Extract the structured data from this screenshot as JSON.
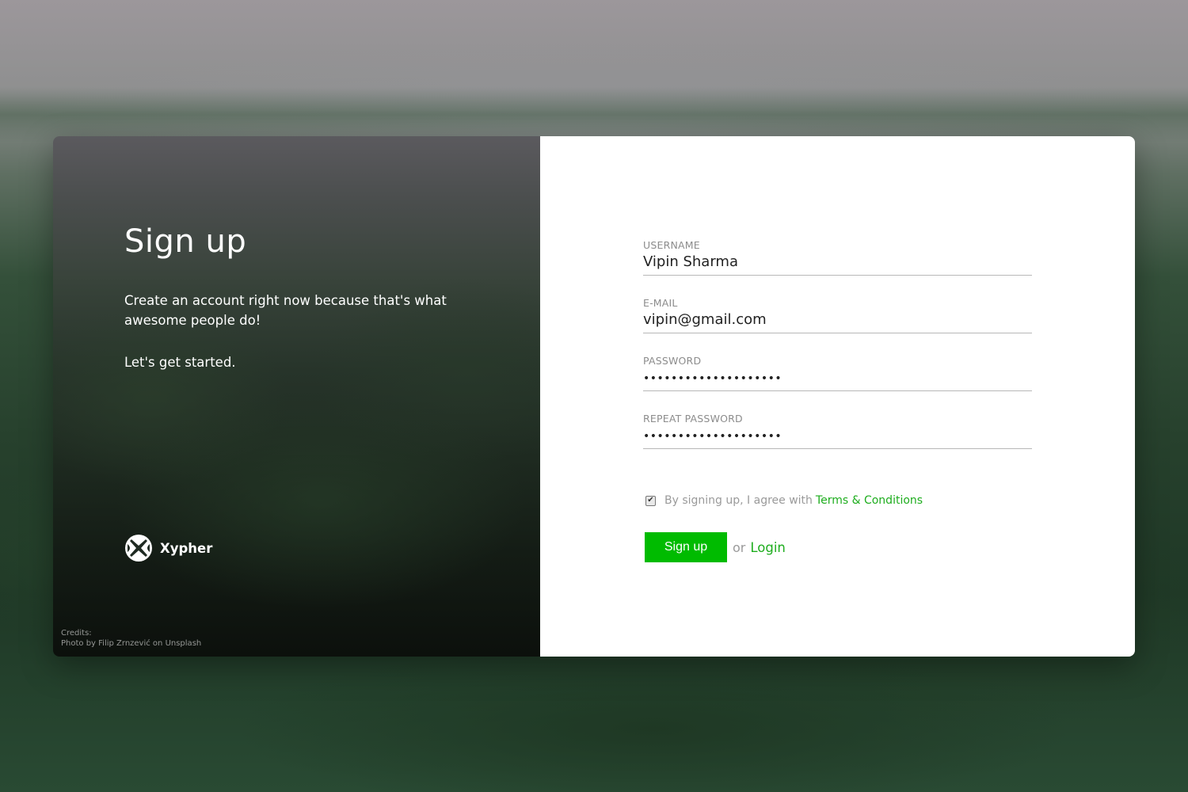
{
  "colors": {
    "accent": "#00bb00",
    "link": "#1ead1e",
    "label": "#8c8c8c",
    "card_right_bg": "#ffffff"
  },
  "left": {
    "title": "Sign up",
    "intro": "Create an account right now because that's what awesome people do!",
    "started": "Let's get started.",
    "brand": {
      "name": "Xypher",
      "icon": "xypher-logo-icon"
    },
    "credits": {
      "label": "Credits:",
      "text": "Photo by Filip Zrnzević on Unsplash"
    }
  },
  "form": {
    "username": {
      "label": "USERNAME",
      "value": "Vipin Sharma"
    },
    "email": {
      "label": "E-MAIL",
      "value": "vipin@gmail.com"
    },
    "password": {
      "label": "PASSWORD",
      "value": "••••••••••••••••••••"
    },
    "repeat_password": {
      "label": "REPEAT PASSWORD",
      "value": "••••••••••••••••••••"
    },
    "agree": {
      "checked": true,
      "text": "By signing up, I agree with",
      "link": "Terms & Conditions"
    },
    "submit_label": "Sign up",
    "or_text": "or",
    "login_label": "Login"
  }
}
